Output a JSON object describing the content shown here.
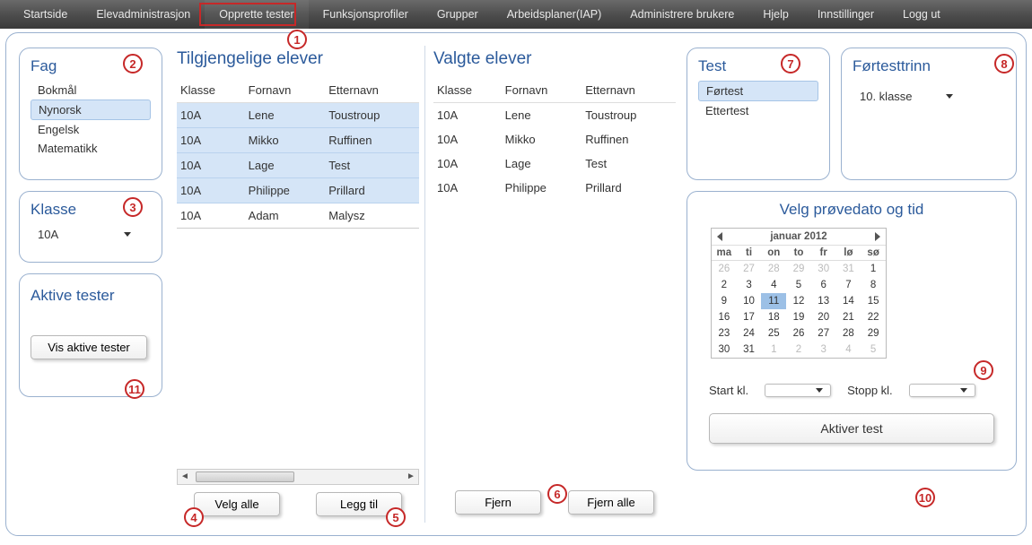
{
  "nav": {
    "items": [
      "Startside",
      "Elevadministrasjon",
      "Opprette tester",
      "Funksjonsprofiler",
      "Grupper",
      "Arbeidsplaner(IAP)",
      "Administrere brukere",
      "Hjelp",
      "Innstillinger",
      "Logg ut"
    ],
    "activeIndex": 2
  },
  "annotations": [
    "1",
    "2",
    "3",
    "4",
    "5",
    "6",
    "7",
    "8",
    "9",
    "10",
    "11"
  ],
  "fag": {
    "title": "Fag",
    "items": [
      "Bokmål",
      "Nynorsk",
      "Engelsk",
      "Matematikk"
    ],
    "selectedIndex": 1
  },
  "klasse": {
    "title": "Klasse",
    "selected": "10A"
  },
  "aktive": {
    "title": "Aktive tester",
    "button": "Vis aktive tester"
  },
  "available": {
    "title": "Tilgjengelige elever",
    "columns": [
      "Klasse",
      "Fornavn",
      "Etternavn"
    ],
    "rows": [
      {
        "klasse": "10A",
        "fornavn": "Lene",
        "etternavn": "Toustroup",
        "hl": true
      },
      {
        "klasse": "10A",
        "fornavn": "Mikko",
        "etternavn": "Ruffinen",
        "hl": true
      },
      {
        "klasse": "10A",
        "fornavn": "Lage",
        "etternavn": "Test",
        "hl": true
      },
      {
        "klasse": "10A",
        "fornavn": "Philippe",
        "etternavn": "Prillard",
        "hl": true
      },
      {
        "klasse": "10A",
        "fornavn": "Adam",
        "etternavn": "Malysz",
        "hl": false
      }
    ],
    "btn_select_all": "Velg alle",
    "btn_add": "Legg til"
  },
  "selected": {
    "title": "Valgte elever",
    "columns": [
      "Klasse",
      "Fornavn",
      "Etternavn"
    ],
    "rows": [
      {
        "klasse": "10A",
        "fornavn": "Lene",
        "etternavn": "Toustroup"
      },
      {
        "klasse": "10A",
        "fornavn": "Mikko",
        "etternavn": "Ruffinen"
      },
      {
        "klasse": "10A",
        "fornavn": "Lage",
        "etternavn": "Test"
      },
      {
        "klasse": "10A",
        "fornavn": "Philippe",
        "etternavn": "Prillard"
      }
    ],
    "btn_remove": "Fjern",
    "btn_remove_all": "Fjern alle"
  },
  "test": {
    "title": "Test",
    "items": [
      "Førtest",
      "Ettertest"
    ],
    "selectedIndex": 0
  },
  "trinn": {
    "title": "Førtesttrinn",
    "selected": "10. klasse"
  },
  "date": {
    "title": "Velg prøvedato og tid",
    "month_label": "januar 2012",
    "dows": [
      "ma",
      "ti",
      "on",
      "to",
      "fr",
      "lø",
      "sø"
    ],
    "days": [
      {
        "n": "26",
        "dim": true
      },
      {
        "n": "27",
        "dim": true
      },
      {
        "n": "28",
        "dim": true
      },
      {
        "n": "29",
        "dim": true
      },
      {
        "n": "30",
        "dim": true
      },
      {
        "n": "31",
        "dim": true
      },
      {
        "n": "1"
      },
      {
        "n": "2"
      },
      {
        "n": "3"
      },
      {
        "n": "4"
      },
      {
        "n": "5"
      },
      {
        "n": "6"
      },
      {
        "n": "7"
      },
      {
        "n": "8"
      },
      {
        "n": "9"
      },
      {
        "n": "10"
      },
      {
        "n": "11",
        "sel": true
      },
      {
        "n": "12"
      },
      {
        "n": "13"
      },
      {
        "n": "14"
      },
      {
        "n": "15"
      },
      {
        "n": "16"
      },
      {
        "n": "17"
      },
      {
        "n": "18"
      },
      {
        "n": "19"
      },
      {
        "n": "20"
      },
      {
        "n": "21"
      },
      {
        "n": "22"
      },
      {
        "n": "23"
      },
      {
        "n": "24"
      },
      {
        "n": "25"
      },
      {
        "n": "26"
      },
      {
        "n": "27"
      },
      {
        "n": "28"
      },
      {
        "n": "29"
      },
      {
        "n": "30"
      },
      {
        "n": "31"
      },
      {
        "n": "1",
        "dim": true
      },
      {
        "n": "2",
        "dim": true
      },
      {
        "n": "3",
        "dim": true
      },
      {
        "n": "4",
        "dim": true
      },
      {
        "n": "5",
        "dim": true
      }
    ],
    "start_label": "Start kl.",
    "stop_label": "Stopp kl.",
    "start_value": "",
    "stop_value": "",
    "activate_label": "Aktiver test"
  }
}
